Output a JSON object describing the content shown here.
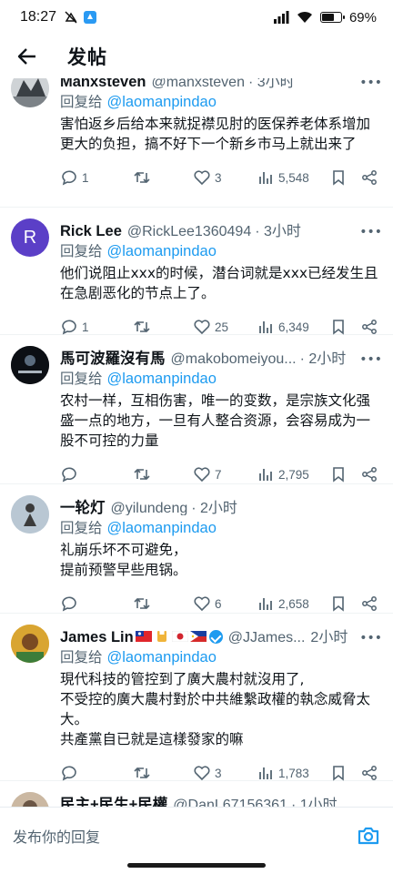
{
  "status": {
    "time": "18:27",
    "battery": "69%",
    "battery_level": 0.69
  },
  "header": {
    "title": "发帖"
  },
  "replying_label": "回复给",
  "replies": [
    {
      "name": "Manxsteven",
      "handle": "@manxsteven",
      "time": "· 3小时",
      "replying_to": "@laomanpindao",
      "body": [
        "害怕返乡后给本来就捉襟见肘的医保养老体系增加更大的负担，搞不好下一个新乡市马上就出来了"
      ],
      "replies": "1",
      "likes": "3",
      "views": "5,548"
    },
    {
      "name": "Rick Lee",
      "handle": "@RickLee1360494",
      "time": "· 3小时",
      "avatar_letter": "R",
      "replying_to": "@laomanpindao",
      "body": [
        "他们说阻止xxx的时候，潜台词就是xxx已经发生且在急剧恶化的节点上了。"
      ],
      "replies": "1",
      "likes": "25",
      "views": "6,349"
    },
    {
      "name": "馬可波羅沒有馬",
      "handle": "@makobomeiyou...",
      "time": "· 2小时",
      "replying_to": "@laomanpindao",
      "body": [
        "农村一样，互相伤害，唯一的变数，是宗族文化强盛一点的地方，一旦有人整合资源，会容易成为一股不可控的力量"
      ],
      "replies": "",
      "likes": "7",
      "views": "2,795"
    },
    {
      "name": "一轮灯",
      "handle": "@yilundeng",
      "time": "· 2小时",
      "replying_to": "@laomanpindao",
      "body": [
        "礼崩乐坏不可避免，",
        "提前预警早些甩锅。"
      ],
      "replies": "",
      "likes": "6",
      "views": "2,658"
    },
    {
      "name": "James Lin",
      "handle": "@JJames...",
      "time": "2小时",
      "replying_to": "@laomanpindao",
      "body": [
        "現代科技的管控到了廣大農村就沒用了,",
        "不受控的廣大農村對於中共維繫政權的執念威脅太大。",
        "共產黨自已就是這樣發家的嘛"
      ],
      "replies": "",
      "likes": "3",
      "views": "1,783"
    },
    {
      "name": "民主+民生+民權",
      "handle": "@DanL67156361",
      "time": "· 1小时",
      "replying_to": "",
      "body": [],
      "replies": "",
      "likes": "",
      "views": ""
    }
  ],
  "compose": {
    "placeholder": "发布你的回复"
  },
  "icons": {
    "back": "back-arrow-icon",
    "reply": "reply-icon",
    "retweet": "retweet-icon",
    "like": "heart-icon",
    "views": "views-chart-icon",
    "bookmark": "bookmark-icon",
    "share": "share-icon",
    "camera": "camera-icon"
  },
  "colors": {
    "accent": "#1d9bf0",
    "muted": "#536471",
    "text": "#0f1419"
  }
}
